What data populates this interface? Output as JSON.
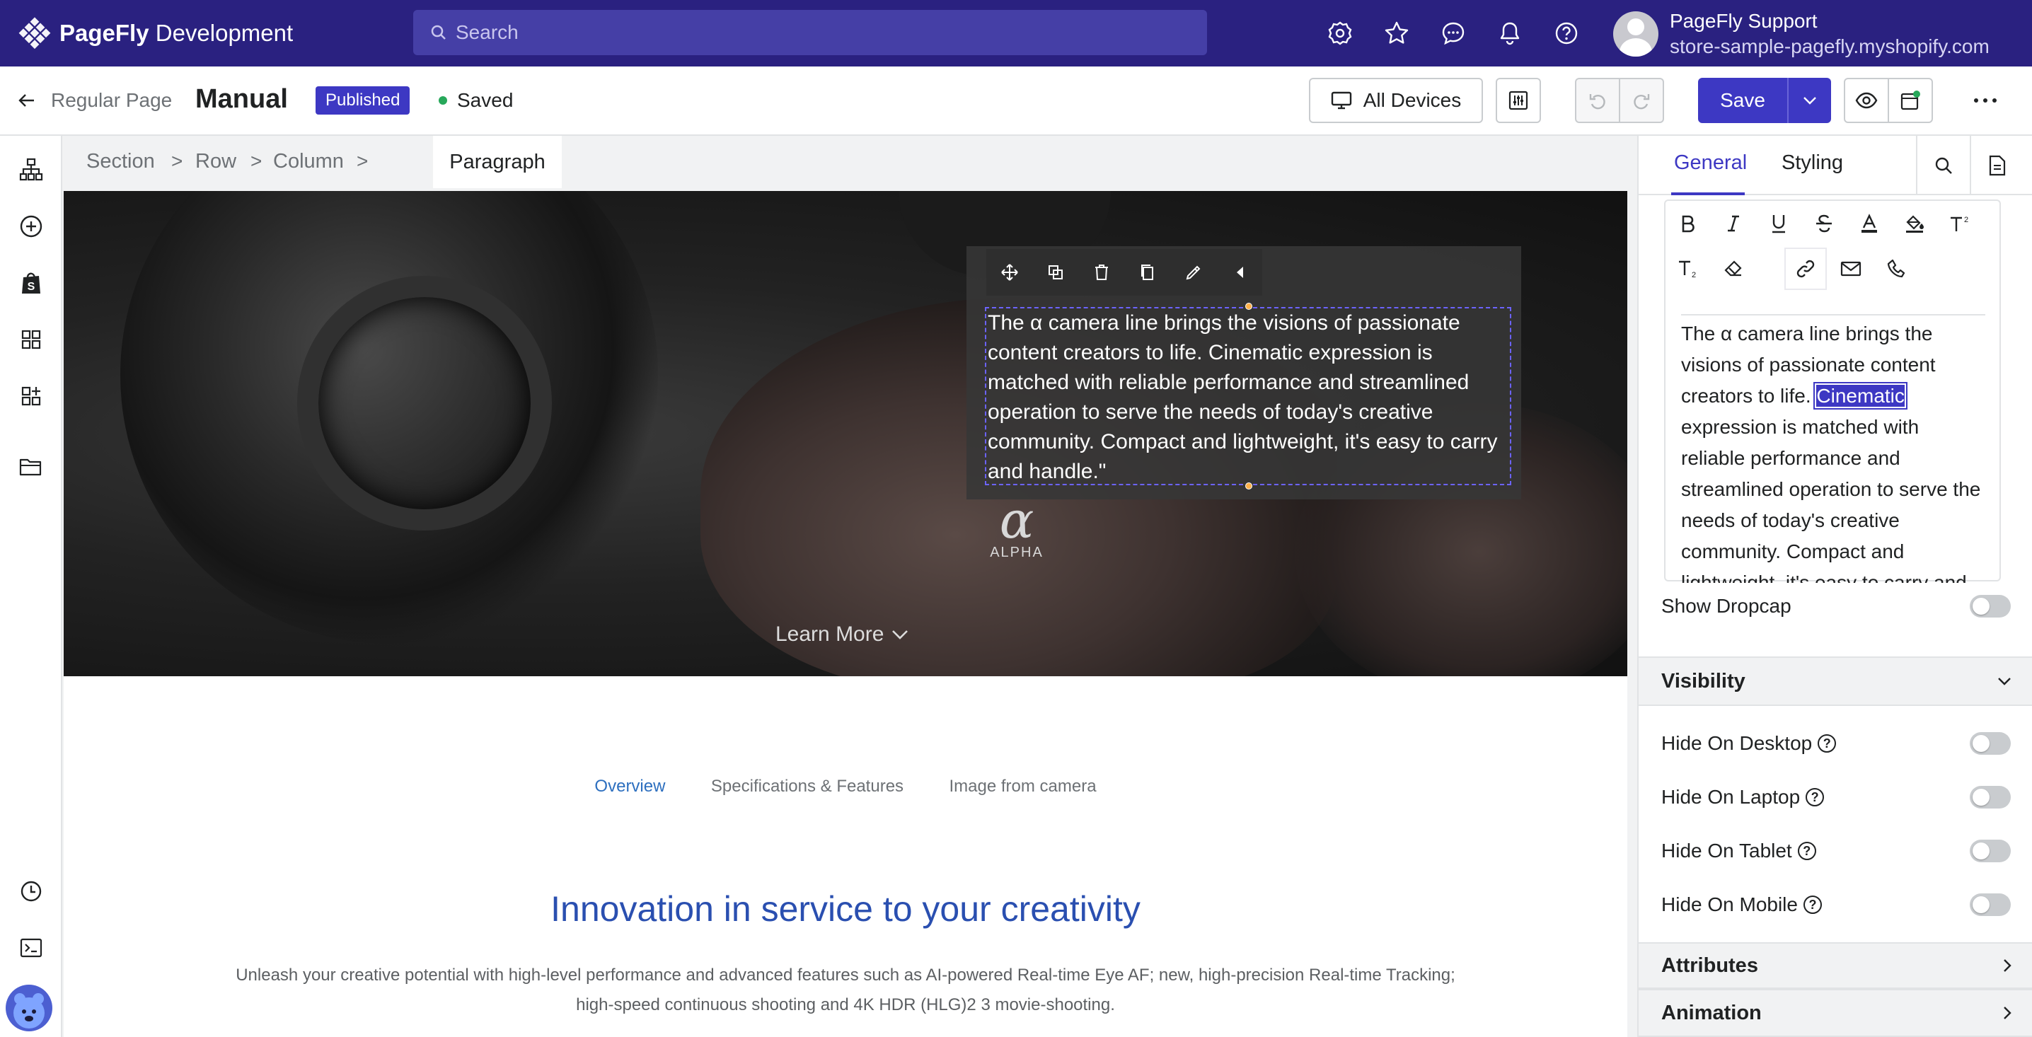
{
  "app": {
    "name_bold": "PageFly",
    "name_rest": " Development"
  },
  "search": {
    "placeholder": "Search"
  },
  "user": {
    "name": "PageFly Support",
    "store": "store-sample-pagefly.myshopify.com"
  },
  "header": {
    "back_label": "Regular Page",
    "page_name": "Manual",
    "status_badge": "Published",
    "save_state": "Saved",
    "devices_label": "All Devices",
    "save_label": "Save"
  },
  "breadcrumb": [
    "Section",
    "Row",
    "Column",
    "Paragraph"
  ],
  "hero": {
    "paragraph": "The α camera line brings the visions of passionate content creators to life. Cinematic expression is matched with reliable performance and streamlined operation to serve the needs of today's creative community. Compact and lightweight, it's easy to carry and handle.\"",
    "logo_symbol": "α",
    "logo_text": "ALPHA",
    "learn_more": "Learn More"
  },
  "content": {
    "tabs": [
      "Overview",
      "Specifications & Features",
      "Image from camera"
    ],
    "heading": "Innovation in service to your creativity",
    "description": "Unleash your creative potential with high-level performance and advanced features such as AI-powered Real-time Eye AF; new, high-precision Real-time Tracking; high-speed continuous shooting and 4K HDR (HLG)2 3 movie-shooting."
  },
  "panel": {
    "tab_general": "General",
    "tab_styling": "Styling",
    "editor": {
      "before": "The α camera line brings the visions of passionate content creators to life. ",
      "selected": "Cinematic",
      "after": " expression is matched with reliable performance and streamlined operation to serve the needs of today's creative community. Compact and lightweight, it's easy to carry and handle."
    },
    "show_dropcap": "Show Dropcap",
    "visibility": "Visibility",
    "hide_desktop": "Hide On Desktop",
    "hide_laptop": "Hide On Laptop",
    "hide_tablet": "Hide On Tablet",
    "hide_mobile": "Hide On Mobile",
    "attributes": "Attributes",
    "animation": "Animation"
  },
  "colors": {
    "topbar": "#2a2180",
    "accent": "#3d38c3",
    "heading": "#2a4fb0"
  }
}
